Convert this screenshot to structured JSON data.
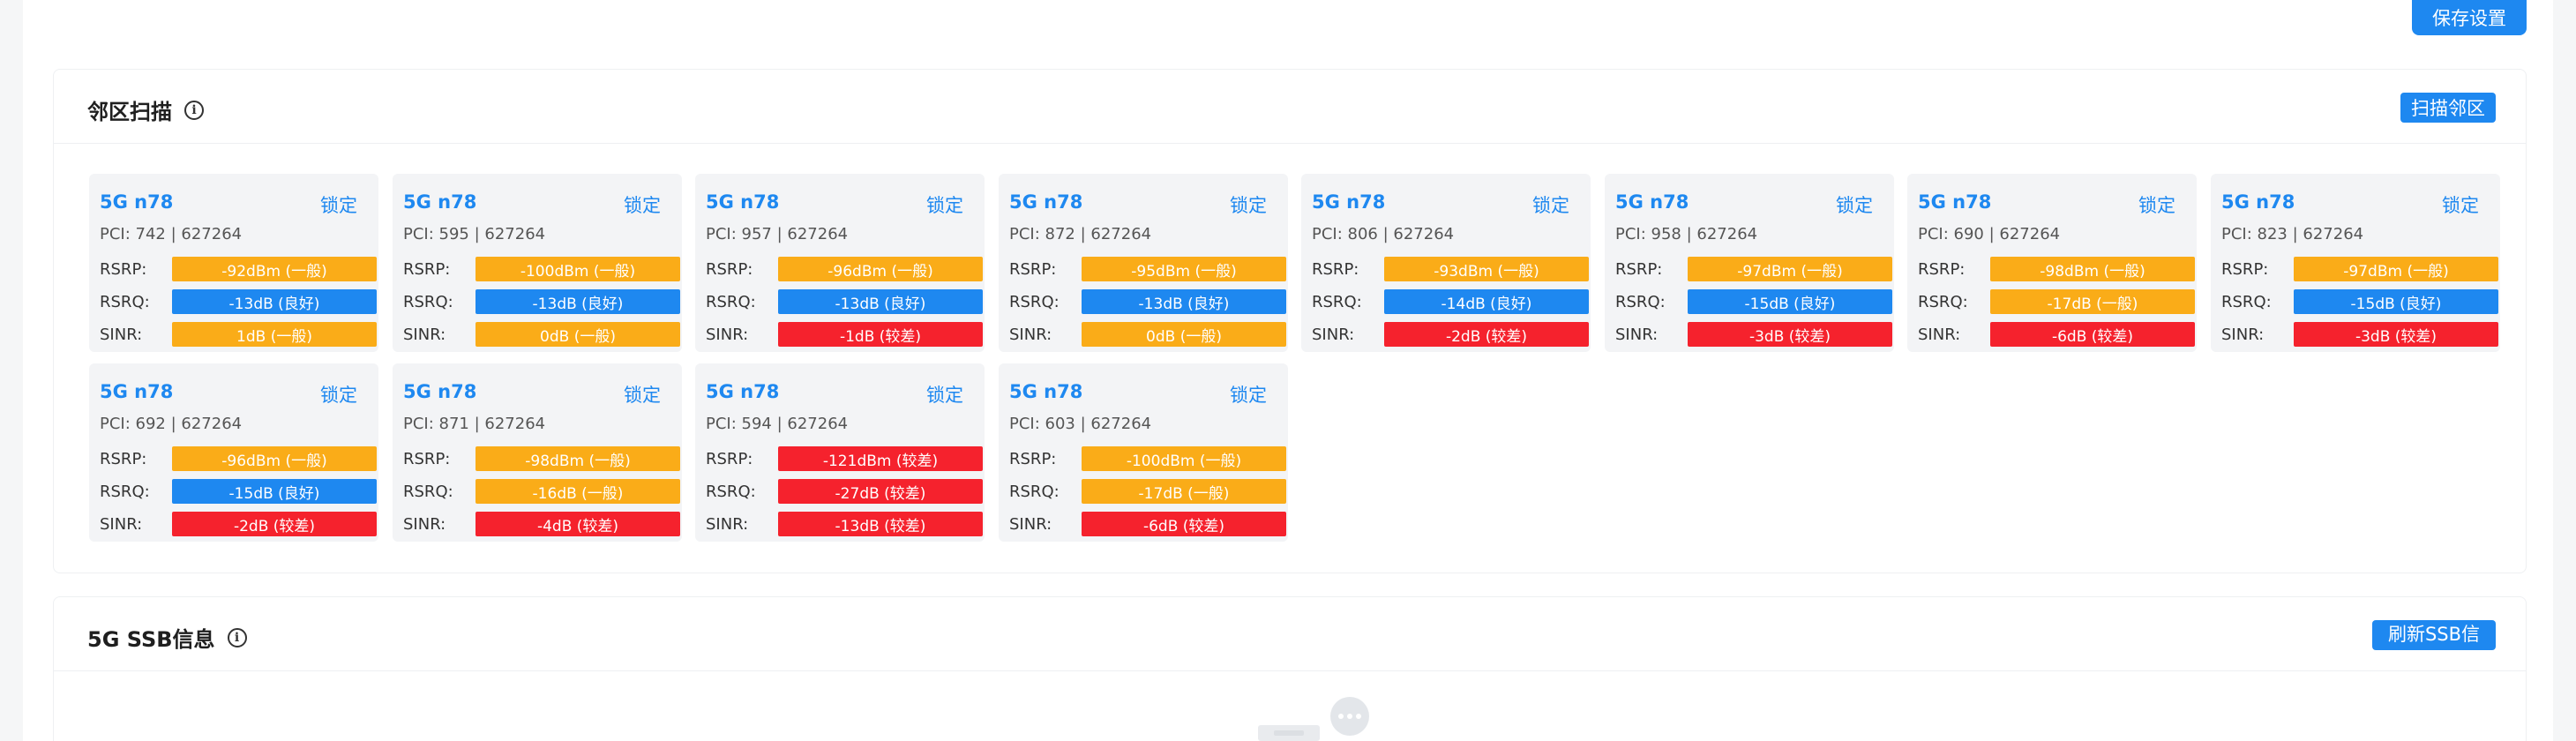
{
  "toolbar": {
    "save_label": "保存设置"
  },
  "neighbor_section": {
    "title": "邻区扫描",
    "scan_label": "扫描邻区"
  },
  "ssb_section": {
    "title": "5G SSB信息",
    "refresh_label": "刷新SSB信息"
  },
  "labels": {
    "rsrp": "RSRP:",
    "rsrq": "RSRQ:",
    "sinr": "SINR:",
    "lock": "锁定"
  },
  "colors": {
    "good": "#1e88f0",
    "medium": "#faac18",
    "poor": "#f5222d"
  },
  "cells": [
    {
      "band": "5G n78",
      "meta": "PCI: 742 | 627264",
      "rsrp": "-92dBm (一般)",
      "rsrp_level": "medium",
      "rsrq": "-13dB (良好)",
      "rsrq_level": "good",
      "sinr": "1dB (一般)",
      "sinr_level": "medium"
    },
    {
      "band": "5G n78",
      "meta": "PCI: 595 | 627264",
      "rsrp": "-100dBm (一般)",
      "rsrp_level": "medium",
      "rsrq": "-13dB (良好)",
      "rsrq_level": "good",
      "sinr": "0dB (一般)",
      "sinr_level": "medium"
    },
    {
      "band": "5G n78",
      "meta": "PCI: 957 | 627264",
      "rsrp": "-96dBm (一般)",
      "rsrp_level": "medium",
      "rsrq": "-13dB (良好)",
      "rsrq_level": "good",
      "sinr": "-1dB (较差)",
      "sinr_level": "poor"
    },
    {
      "band": "5G n78",
      "meta": "PCI: 872 | 627264",
      "rsrp": "-95dBm (一般)",
      "rsrp_level": "medium",
      "rsrq": "-13dB (良好)",
      "rsrq_level": "good",
      "sinr": "0dB (一般)",
      "sinr_level": "medium"
    },
    {
      "band": "5G n78",
      "meta": "PCI: 806 | 627264",
      "rsrp": "-93dBm (一般)",
      "rsrp_level": "medium",
      "rsrq": "-14dB (良好)",
      "rsrq_level": "good",
      "sinr": "-2dB (较差)",
      "sinr_level": "poor"
    },
    {
      "band": "5G n78",
      "meta": "PCI: 958 | 627264",
      "rsrp": "-97dBm (一般)",
      "rsrp_level": "medium",
      "rsrq": "-15dB (良好)",
      "rsrq_level": "good",
      "sinr": "-3dB (较差)",
      "sinr_level": "poor"
    },
    {
      "band": "5G n78",
      "meta": "PCI: 690 | 627264",
      "rsrp": "-98dBm (一般)",
      "rsrp_level": "medium",
      "rsrq": "-17dB (一般)",
      "rsrq_level": "medium",
      "sinr": "-6dB (较差)",
      "sinr_level": "poor"
    },
    {
      "band": "5G n78",
      "meta": "PCI: 823 | 627264",
      "rsrp": "-97dBm (一般)",
      "rsrp_level": "medium",
      "rsrq": "-15dB (良好)",
      "rsrq_level": "good",
      "sinr": "-3dB (较差)",
      "sinr_level": "poor"
    },
    {
      "band": "5G n78",
      "meta": "PCI: 692 | 627264",
      "rsrp": "-96dBm (一般)",
      "rsrp_level": "medium",
      "rsrq": "-15dB (良好)",
      "rsrq_level": "good",
      "sinr": "-2dB (较差)",
      "sinr_level": "poor"
    },
    {
      "band": "5G n78",
      "meta": "PCI: 871 | 627264",
      "rsrp": "-98dBm (一般)",
      "rsrp_level": "medium",
      "rsrq": "-16dB (一般)",
      "rsrq_level": "medium",
      "sinr": "-4dB (较差)",
      "sinr_level": "poor"
    },
    {
      "band": "5G n78",
      "meta": "PCI: 594 | 627264",
      "rsrp": "-121dBm (较差)",
      "rsrp_level": "poor",
      "rsrq": "-27dB (较差)",
      "rsrq_level": "poor",
      "sinr": "-13dB (较差)",
      "sinr_level": "poor"
    },
    {
      "band": "5G n78",
      "meta": "PCI: 603 | 627264",
      "rsrp": "-100dBm (一般)",
      "rsrp_level": "medium",
      "rsrq": "-17dB (一般)",
      "rsrq_level": "medium",
      "sinr": "-6dB (较差)",
      "sinr_level": "poor"
    }
  ]
}
